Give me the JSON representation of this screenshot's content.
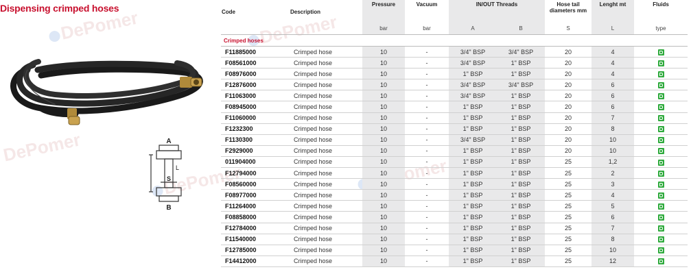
{
  "page": {
    "title": "Dispensing crimped hoses",
    "watermark_text": "DePomer"
  },
  "diagram": {
    "label_a": "A",
    "label_l": "L",
    "label_s": "S",
    "label_b": "B"
  },
  "table": {
    "headers": {
      "code": "Code",
      "description": "Description",
      "pressure": "Pressure",
      "vacuum": "Vacuum",
      "threads": "IN/OUT Threads",
      "hose_tail": "Hose tail diameters mm",
      "length": "Lenght mt",
      "fluids": "Fluids"
    },
    "units": {
      "pressure": "bar",
      "vacuum": "bar",
      "a": "A",
      "b": "B",
      "s": "S",
      "l": "L",
      "fluids": "type"
    },
    "section_label": "Crimped hoses",
    "fluid_icon_color": "#2eaa3c",
    "accent_color": "#c8102e",
    "rows": [
      {
        "code": "F11885000",
        "desc": "Crimped hose",
        "pressure": "10",
        "vacuum": "-",
        "a": "3/4\" BSP",
        "b": "3/4\" BSP",
        "s": "20",
        "l": "4"
      },
      {
        "code": "F08561000",
        "desc": "Crimped hose",
        "pressure": "10",
        "vacuum": "-",
        "a": "3/4\" BSP",
        "b": "1\" BSP",
        "s": "20",
        "l": "4"
      },
      {
        "code": "F08976000",
        "desc": "Crimped hose",
        "pressure": "10",
        "vacuum": "-",
        "a": "1\" BSP",
        "b": "1\" BSP",
        "s": "20",
        "l": "4"
      },
      {
        "code": "F12876000",
        "desc": "Crimped hose",
        "pressure": "10",
        "vacuum": "-",
        "a": "3/4\" BSP",
        "b": "3/4\" BSP",
        "s": "20",
        "l": "6"
      },
      {
        "code": "F11063000",
        "desc": "Crimped hose",
        "pressure": "10",
        "vacuum": "-",
        "a": "3/4\" BSP",
        "b": "1\" BSP",
        "s": "20",
        "l": "6"
      },
      {
        "code": "F08945000",
        "desc": "Crimped hose",
        "pressure": "10",
        "vacuum": "-",
        "a": "1\" BSP",
        "b": "1\" BSP",
        "s": "20",
        "l": "6"
      },
      {
        "code": "F11060000",
        "desc": "Crimped hose",
        "pressure": "10",
        "vacuum": "-",
        "a": "1\" BSP",
        "b": "1\" BSP",
        "s": "20",
        "l": "7"
      },
      {
        "code": "F1232300",
        "desc": "Crimped hose",
        "pressure": "10",
        "vacuum": "-",
        "a": "1\" BSP",
        "b": "1\" BSP",
        "s": "20",
        "l": "8"
      },
      {
        "code": "F1130300",
        "desc": "Crimped hose",
        "pressure": "10",
        "vacuum": "-",
        "a": "3/4\" BSP",
        "b": "1\" BSP",
        "s": "20",
        "l": "10"
      },
      {
        "code": "F2929000",
        "desc": "Crimped hose",
        "pressure": "10",
        "vacuum": "-",
        "a": "1\" BSP",
        "b": "1\" BSP",
        "s": "20",
        "l": "10"
      },
      {
        "code": "011904000",
        "desc": "Crimped hose",
        "pressure": "10",
        "vacuum": "-",
        "a": "1\" BSP",
        "b": "1\" BSP",
        "s": "25",
        "l": "1,2"
      },
      {
        "code": "F12794000",
        "desc": "Crimped hose",
        "pressure": "10",
        "vacuum": "-",
        "a": "1\" BSP",
        "b": "1\" BSP",
        "s": "25",
        "l": "2"
      },
      {
        "code": "F08560000",
        "desc": "Crimped hose",
        "pressure": "10",
        "vacuum": "-",
        "a": "1\" BSP",
        "b": "1\" BSP",
        "s": "25",
        "l": "3"
      },
      {
        "code": "F08977000",
        "desc": "Crimped hose",
        "pressure": "10",
        "vacuum": "-",
        "a": "1\" BSP",
        "b": "1\" BSP",
        "s": "25",
        "l": "4"
      },
      {
        "code": "F11264000",
        "desc": "Crimped hose",
        "pressure": "10",
        "vacuum": "-",
        "a": "1\" BSP",
        "b": "1\" BSP",
        "s": "25",
        "l": "5"
      },
      {
        "code": "F08858000",
        "desc": "Crimped hose",
        "pressure": "10",
        "vacuum": "-",
        "a": "1\" BSP",
        "b": "1\" BSP",
        "s": "25",
        "l": "6"
      },
      {
        "code": "F12784000",
        "desc": "Crimped hose",
        "pressure": "10",
        "vacuum": "-",
        "a": "1\" BSP",
        "b": "1\" BSP",
        "s": "25",
        "l": "7"
      },
      {
        "code": "F11540000",
        "desc": "Crimped hose",
        "pressure": "10",
        "vacuum": "-",
        "a": "1\" BSP",
        "b": "1\" BSP",
        "s": "25",
        "l": "8"
      },
      {
        "code": "F12785000",
        "desc": "Crimped hose",
        "pressure": "10",
        "vacuum": "-",
        "a": "1\" BSP",
        "b": "1\" BSP",
        "s": "25",
        "l": "10"
      },
      {
        "code": "F14412000",
        "desc": "Crimped hose",
        "pressure": "10",
        "vacuum": "-",
        "a": "1\" BSP",
        "b": "1\" BSP",
        "s": "25",
        "l": "12"
      }
    ]
  }
}
